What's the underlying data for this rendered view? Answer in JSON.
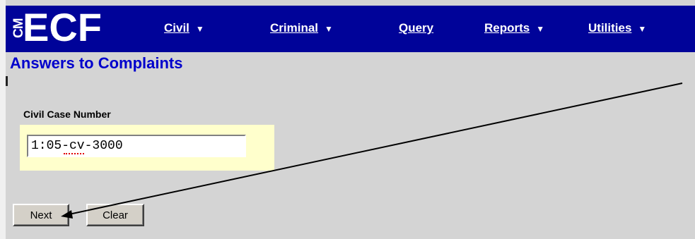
{
  "navbar": {
    "logo_cm": "CM",
    "logo_ecf": "ECF",
    "menu": [
      {
        "label": "Civil",
        "has_dropdown": true
      },
      {
        "label": "Criminal",
        "has_dropdown": true
      },
      {
        "label": "Query",
        "has_dropdown": false
      },
      {
        "label": "Reports",
        "has_dropdown": true
      },
      {
        "label": "Utilities",
        "has_dropdown": true
      }
    ]
  },
  "page": {
    "title": "Answers to Complaints"
  },
  "form": {
    "case_number_label": "Civil Case Number",
    "case_number_value": "1:05-cv-3000"
  },
  "buttons": {
    "next_label": "Next",
    "clear_label": "Clear"
  },
  "colors": {
    "navbar_bg": "#000399",
    "title": "#0000cc",
    "field_panel_bg": "#ffffcc",
    "page_bg": "#d4d4d4"
  }
}
